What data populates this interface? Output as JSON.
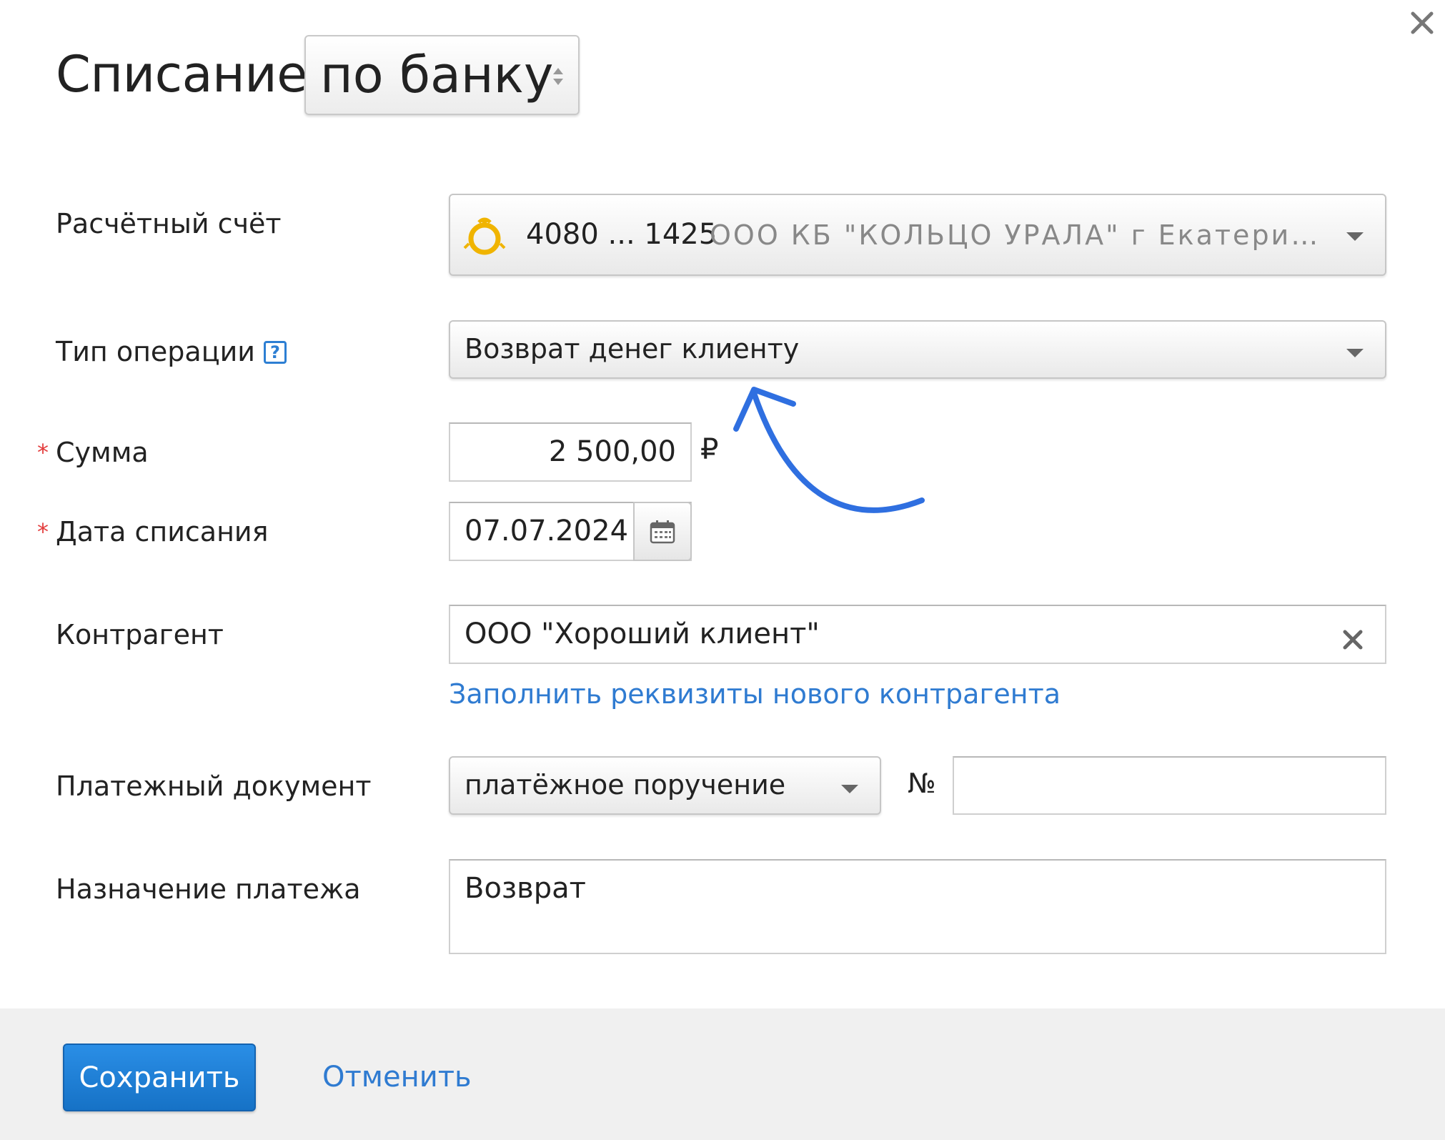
{
  "dialog": {
    "title": "Списание",
    "type_value": "по банку",
    "close_icon": "close-icon"
  },
  "fields": {
    "account": {
      "label": "Расчётный счёт",
      "number": "4080 ... 1425",
      "bank": "ООО КБ \"КОЛЬЦО УРАЛА\" г Екатеринб...",
      "bank_logo_color": "#f0b400"
    },
    "operation_type": {
      "label": "Тип операции",
      "help": "?",
      "value": "Возврат денег клиенту"
    },
    "amount": {
      "required_mark": "*",
      "label": "Сумма",
      "value": "2 500,00",
      "currency": "₽"
    },
    "date": {
      "required_mark": "*",
      "label": "Дата списания",
      "value": "07.07.2024"
    },
    "contractor": {
      "label": "Контрагент",
      "value": "ООО \"Хороший клиент\"",
      "new_link": "Заполнить реквизиты нового контрагента"
    },
    "payment_doc": {
      "label": "Платежный документ",
      "value": "платёжное поручение",
      "number_label": "№",
      "number_value": ""
    },
    "purpose": {
      "label": "Назначение платежа",
      "value": "Возврат"
    }
  },
  "footer": {
    "save_label": "Сохранить",
    "cancel_label": "Отменить"
  },
  "colors": {
    "accent": "#1a7ad4",
    "link": "#2f7bd1",
    "required": "#e33d3d",
    "annotation_arrow": "#2f6fe0"
  }
}
